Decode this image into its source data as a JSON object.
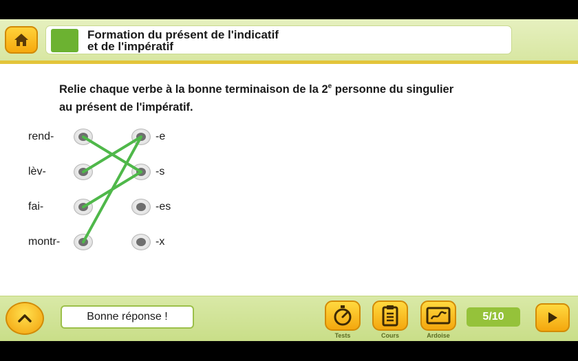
{
  "header": {
    "title_line1": "Formation du présent de l'indicatif",
    "title_line2": "et de l'impératif",
    "accent_color": "#6cb231"
  },
  "instruction": {
    "part1": "Relie chaque verbe à la bonne terminaison de la 2",
    "superscript": "e",
    "part2": " personne du singulier",
    "line2": "au présent de l'impératif."
  },
  "exercise": {
    "left_words": [
      "rend-",
      "lèv-",
      "fai-",
      "montr-"
    ],
    "right_endings": [
      "-e",
      "-s",
      "-es",
      "-x"
    ],
    "connections": [
      {
        "from": "rend-",
        "to": "-s"
      },
      {
        "from": "lèv-",
        "to": "-e"
      },
      {
        "from": "fai-",
        "to": "-s"
      },
      {
        "from": "montr-",
        "to": "-e"
      }
    ],
    "line_color": "#4fb84a"
  },
  "footer": {
    "feedback": "Bonne réponse !",
    "tools": [
      {
        "label": "Tests",
        "icon": "stopwatch-icon"
      },
      {
        "label": "Cours",
        "icon": "clipboard-icon"
      },
      {
        "label": "Ardoise",
        "icon": "slate-icon"
      }
    ],
    "progress": "5/10"
  }
}
